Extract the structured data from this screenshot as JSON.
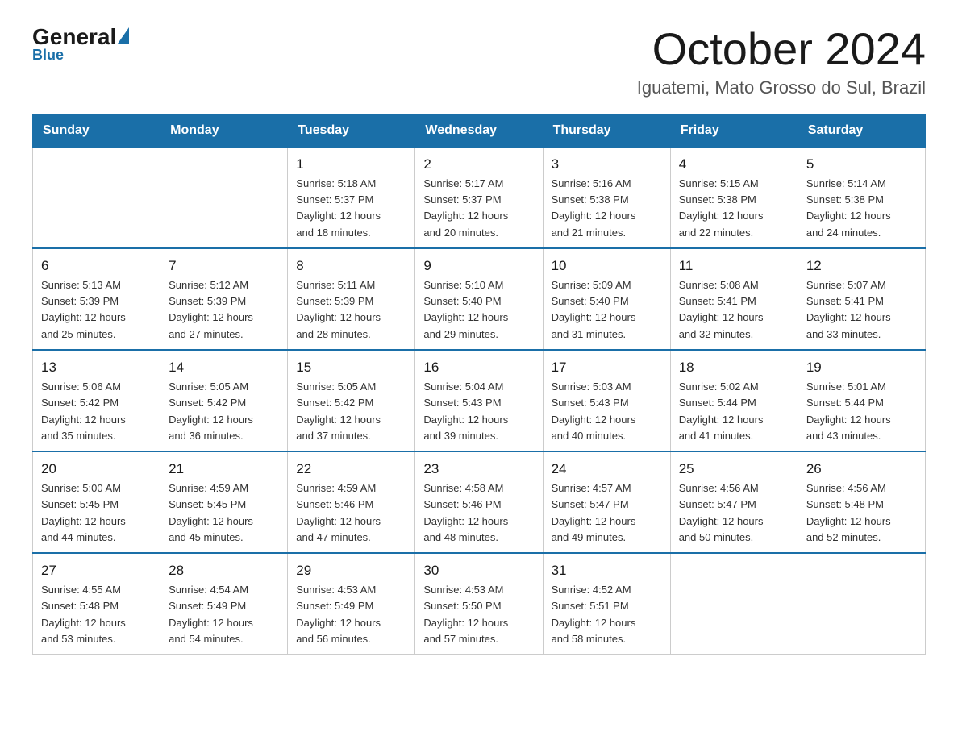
{
  "header": {
    "logo_general": "General",
    "logo_blue": "Blue",
    "title": "October 2024",
    "subtitle": "Iguatemi, Mato Grosso do Sul, Brazil"
  },
  "days_of_week": [
    "Sunday",
    "Monday",
    "Tuesday",
    "Wednesday",
    "Thursday",
    "Friday",
    "Saturday"
  ],
  "weeks": [
    [
      {
        "day": "",
        "info": ""
      },
      {
        "day": "",
        "info": ""
      },
      {
        "day": "1",
        "info": "Sunrise: 5:18 AM\nSunset: 5:37 PM\nDaylight: 12 hours\nand 18 minutes."
      },
      {
        "day": "2",
        "info": "Sunrise: 5:17 AM\nSunset: 5:37 PM\nDaylight: 12 hours\nand 20 minutes."
      },
      {
        "day": "3",
        "info": "Sunrise: 5:16 AM\nSunset: 5:38 PM\nDaylight: 12 hours\nand 21 minutes."
      },
      {
        "day": "4",
        "info": "Sunrise: 5:15 AM\nSunset: 5:38 PM\nDaylight: 12 hours\nand 22 minutes."
      },
      {
        "day": "5",
        "info": "Sunrise: 5:14 AM\nSunset: 5:38 PM\nDaylight: 12 hours\nand 24 minutes."
      }
    ],
    [
      {
        "day": "6",
        "info": "Sunrise: 5:13 AM\nSunset: 5:39 PM\nDaylight: 12 hours\nand 25 minutes."
      },
      {
        "day": "7",
        "info": "Sunrise: 5:12 AM\nSunset: 5:39 PM\nDaylight: 12 hours\nand 27 minutes."
      },
      {
        "day": "8",
        "info": "Sunrise: 5:11 AM\nSunset: 5:39 PM\nDaylight: 12 hours\nand 28 minutes."
      },
      {
        "day": "9",
        "info": "Sunrise: 5:10 AM\nSunset: 5:40 PM\nDaylight: 12 hours\nand 29 minutes."
      },
      {
        "day": "10",
        "info": "Sunrise: 5:09 AM\nSunset: 5:40 PM\nDaylight: 12 hours\nand 31 minutes."
      },
      {
        "day": "11",
        "info": "Sunrise: 5:08 AM\nSunset: 5:41 PM\nDaylight: 12 hours\nand 32 minutes."
      },
      {
        "day": "12",
        "info": "Sunrise: 5:07 AM\nSunset: 5:41 PM\nDaylight: 12 hours\nand 33 minutes."
      }
    ],
    [
      {
        "day": "13",
        "info": "Sunrise: 5:06 AM\nSunset: 5:42 PM\nDaylight: 12 hours\nand 35 minutes."
      },
      {
        "day": "14",
        "info": "Sunrise: 5:05 AM\nSunset: 5:42 PM\nDaylight: 12 hours\nand 36 minutes."
      },
      {
        "day": "15",
        "info": "Sunrise: 5:05 AM\nSunset: 5:42 PM\nDaylight: 12 hours\nand 37 minutes."
      },
      {
        "day": "16",
        "info": "Sunrise: 5:04 AM\nSunset: 5:43 PM\nDaylight: 12 hours\nand 39 minutes."
      },
      {
        "day": "17",
        "info": "Sunrise: 5:03 AM\nSunset: 5:43 PM\nDaylight: 12 hours\nand 40 minutes."
      },
      {
        "day": "18",
        "info": "Sunrise: 5:02 AM\nSunset: 5:44 PM\nDaylight: 12 hours\nand 41 minutes."
      },
      {
        "day": "19",
        "info": "Sunrise: 5:01 AM\nSunset: 5:44 PM\nDaylight: 12 hours\nand 43 minutes."
      }
    ],
    [
      {
        "day": "20",
        "info": "Sunrise: 5:00 AM\nSunset: 5:45 PM\nDaylight: 12 hours\nand 44 minutes."
      },
      {
        "day": "21",
        "info": "Sunrise: 4:59 AM\nSunset: 5:45 PM\nDaylight: 12 hours\nand 45 minutes."
      },
      {
        "day": "22",
        "info": "Sunrise: 4:59 AM\nSunset: 5:46 PM\nDaylight: 12 hours\nand 47 minutes."
      },
      {
        "day": "23",
        "info": "Sunrise: 4:58 AM\nSunset: 5:46 PM\nDaylight: 12 hours\nand 48 minutes."
      },
      {
        "day": "24",
        "info": "Sunrise: 4:57 AM\nSunset: 5:47 PM\nDaylight: 12 hours\nand 49 minutes."
      },
      {
        "day": "25",
        "info": "Sunrise: 4:56 AM\nSunset: 5:47 PM\nDaylight: 12 hours\nand 50 minutes."
      },
      {
        "day": "26",
        "info": "Sunrise: 4:56 AM\nSunset: 5:48 PM\nDaylight: 12 hours\nand 52 minutes."
      }
    ],
    [
      {
        "day": "27",
        "info": "Sunrise: 4:55 AM\nSunset: 5:48 PM\nDaylight: 12 hours\nand 53 minutes."
      },
      {
        "day": "28",
        "info": "Sunrise: 4:54 AM\nSunset: 5:49 PM\nDaylight: 12 hours\nand 54 minutes."
      },
      {
        "day": "29",
        "info": "Sunrise: 4:53 AM\nSunset: 5:49 PM\nDaylight: 12 hours\nand 56 minutes."
      },
      {
        "day": "30",
        "info": "Sunrise: 4:53 AM\nSunset: 5:50 PM\nDaylight: 12 hours\nand 57 minutes."
      },
      {
        "day": "31",
        "info": "Sunrise: 4:52 AM\nSunset: 5:51 PM\nDaylight: 12 hours\nand 58 minutes."
      },
      {
        "day": "",
        "info": ""
      },
      {
        "day": "",
        "info": ""
      }
    ]
  ]
}
